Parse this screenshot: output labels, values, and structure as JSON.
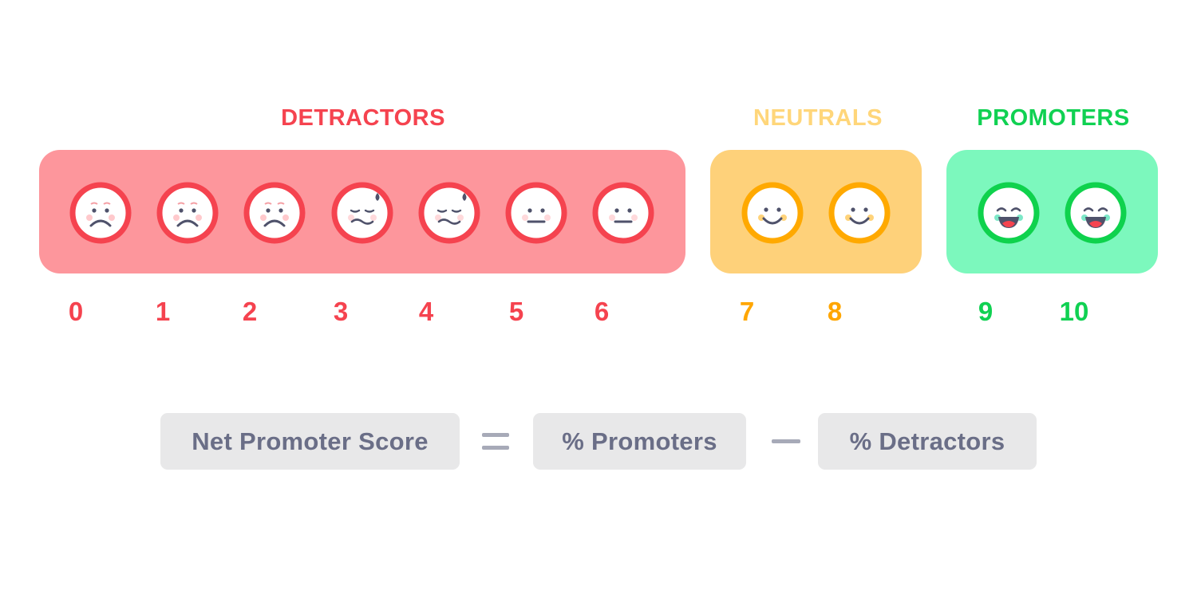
{
  "groups": {
    "detractors": {
      "label": "DETRACTORS",
      "color": "#f5434f",
      "panel_color": "#fd969c"
    },
    "neutrals": {
      "label": "NEUTRALS",
      "color": "#ffd67a",
      "panel_color": "#fed17a",
      "ring_color": "#ffa900"
    },
    "promoters": {
      "label": "PROMOTERS",
      "color": "#10d152",
      "panel_color": "#7cf8bd",
      "ring_color": "#0fd24d"
    }
  },
  "scores": [
    {
      "value": "0",
      "group": "detractors",
      "face": "sad-face-icon"
    },
    {
      "value": "1",
      "group": "detractors",
      "face": "sad-face-icon"
    },
    {
      "value": "2",
      "group": "detractors",
      "face": "sad-face-icon"
    },
    {
      "value": "3",
      "group": "detractors",
      "face": "sweat-face-icon"
    },
    {
      "value": "4",
      "group": "detractors",
      "face": "sweat-face-icon"
    },
    {
      "value": "5",
      "group": "detractors",
      "face": "neutral-face-icon"
    },
    {
      "value": "6",
      "group": "detractors",
      "face": "neutral-face-icon"
    },
    {
      "value": "7",
      "group": "neutrals",
      "face": "smile-face-icon"
    },
    {
      "value": "8",
      "group": "neutrals",
      "face": "smile-face-icon"
    },
    {
      "value": "9",
      "group": "promoters",
      "face": "laugh-face-icon"
    },
    {
      "value": "10",
      "group": "promoters",
      "face": "laugh-face-icon"
    }
  ],
  "score_colors": {
    "detractors": "#f5434f",
    "neutrals": "#ffa600",
    "promoters": "#10d152"
  },
  "formula": {
    "result": "Net Promoter Score",
    "operator_equals": "=",
    "term1": "% Promoters",
    "operator_minus": "−",
    "term2": "% Detractors"
  }
}
